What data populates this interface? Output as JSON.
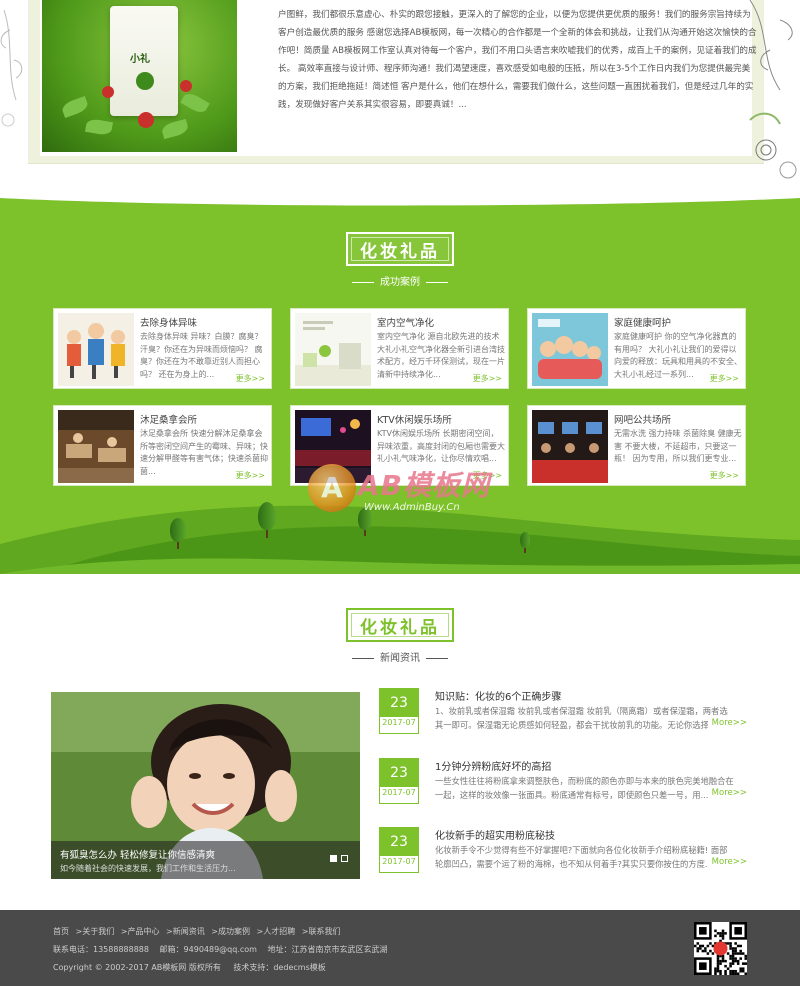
{
  "about": {
    "product_box": {
      "title": "小礼"
    },
    "text": "户图鲜，我们都很乐意虚心、朴实的跟您接触，更深入的了解您的企业，以便为您提供更优质的服务！我们的服务宗旨持续为客户创造最优质的服务 感谢您选择AB模板网，每一次精心的合作都是一个全新的体会和挑战，让我们从沟通开始这次愉快的合作吧！简质量 AB模板网工作室认真对待每一个客户，我们不用口头语言来吹嘘我们的优秀，成百上千的案例，见证着我们的成长。 高效率直接与设计师、程序师沟通！我们渴望速度，喜欢感受如电般的压抵，所以在3-5个工作日内我们为您提供最完美的方案，我们拒绝拖延！简述恒 客户是什么，他们在想什么，需要我们做什么，这些问题一直困扰着我们，但是经过几年的实践，发现做好客户关系其实很容易，即要真诚！..."
  },
  "cases_section": {
    "logo_text": "化妆礼品",
    "subtitle": "成功案例",
    "items": [
      {
        "title": "去除身体异味",
        "desc": "去除身体异味 异味？白膜？腐臭？汗臭？你还在为异味而烦恼吗？ 腐臭？你还在为不敢靠近别人而担心吗？ 还在为身上的... ",
        "more": "更多>>",
        "thumb": "cartoon-people"
      },
      {
        "title": "室内空气净化",
        "desc": "室内空气净化 源自北欧先进的技术 大礼小礼空气净化器全新引进台湾技术配方，经万千环保测试，现在一片清新中持续净化...",
        "more": "更多>>",
        "thumb": "clean-room"
      },
      {
        "title": "家庭健康呵护",
        "desc": "家庭健康呵护 你的空气净化器真的有用吗？ 大礼小礼让我们的爱得以向爱的释放：玩具和用具的不安全、大礼小礼经过一系列...",
        "more": "更多>>",
        "thumb": "family-cartoon"
      },
      {
        "title": "沐足桑拿会所",
        "desc": "沐足桑拿会所 快速分解沐足桑拿会所等密闭空间产生的霉味、异味；快速分解甲醛等有害气体；快速杀菌抑菌...",
        "more": "更多>>",
        "thumb": "spa-room"
      },
      {
        "title": "KTV休闲娱乐场所",
        "desc": "KTV休闲娱乐场所 长期密闭空间，异味浓重，高度封闭的包厢也需要大礼小礼气味净化，让你尽情欢唱...",
        "more": "更多>>",
        "thumb": "ktv-room"
      },
      {
        "title": "网吧公共场所",
        "desc": "无需水洗 强力持味 杀菌除臭 健康无害 不要大楼，不延超市，只要这一瓶！ 因为专用，所以我们更专业...",
        "more": "更多>>",
        "thumb": "internet-cafe"
      }
    ]
  },
  "watermark": {
    "text": "AB模板网",
    "url": "Www.AdminBuy.Cn",
    "mark": "A"
  },
  "news_section": {
    "logo_text": "化妆礼品",
    "subtitle": "新闻资讯",
    "photo_caption": "有狐臭怎么办 轻松修复让你信感清爽",
    "photo_sub": "如今随着社会的快速发展，我们工作和生活压力...",
    "items": [
      {
        "day": "23",
        "ym": "2017-07",
        "title": "知识贴：化妆的6个正确步骤",
        "desc": "1、妆前乳或者保湿霜 妆前乳或者保湿霜 妆前乳（隔离霜）或者保湿霜，两者选其一即可。保湿霜无论质感如何轻盈，都会干扰妆前乳的功能。无论你选择...",
        "more": "More>>"
      },
      {
        "day": "23",
        "ym": "2017-07",
        "title": "1分钟分辨粉底好坏的高招",
        "desc": "一些女性往往将粉底拿来调整肤色，而粉底的颜色亦即与本来的肤色完美地融合在一起，这样的妆效像一张面具。粉底通常有标号，即使颜色只差一号，用...",
        "more": "More>>"
      },
      {
        "day": "23",
        "ym": "2017-07",
        "title": "化妆新手的超实用粉底秘技",
        "desc": "化妆新手令不少觉得有些不好掌握吧?下面就向各位化妆新手介绍粉底秘籍! 面部轮廓凹凸，需要个运了粉的海棉，也不知从何着手?其实只要你按住的方度...",
        "more": "More>>"
      }
    ]
  },
  "footer": {
    "nav": [
      "首页",
      ">关于我们",
      ">产品中心",
      ">新闻资讯",
      ">成功案例",
      ">人才招聘",
      ">联系我们"
    ],
    "phone": "联系电话：13588888888",
    "email": "邮箱：9490489@qq.com",
    "address": "地址：江苏省南京市玄武区玄武湖",
    "copyright": "Copyright © 2002-2017 AB模板网 版权所有",
    "support": "技术支持：dedecms模板"
  },
  "colors": {
    "accent": "#7dc22b",
    "footer_bg": "#4a4a4a"
  }
}
